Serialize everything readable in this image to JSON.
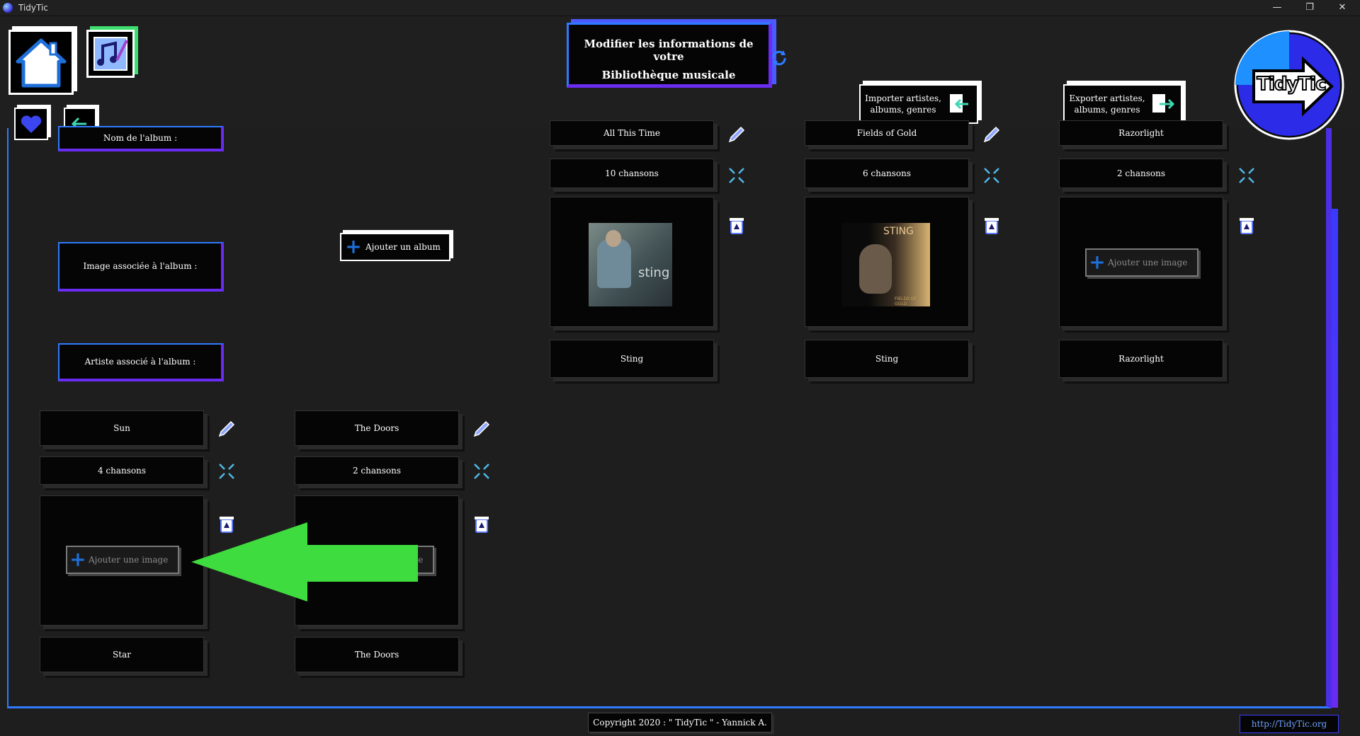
{
  "window": {
    "title": "TidyTic",
    "minimize": "—",
    "restore": "❐",
    "close": "✕"
  },
  "header": {
    "banner_line1": "Modifier les informations de votre",
    "banner_line2": "Bibliothèque musicale",
    "import_label": "Importer artistes, albums, genres",
    "export_label": "Exporter artistes, albums, genres",
    "logo_text": "TidyTic"
  },
  "form": {
    "album_name_label": "Nom de l'album :",
    "album_image_label": "Image associée à l'album :",
    "album_artist_label": "Artiste associé à l'album :",
    "add_album_label": "Ajouter un album"
  },
  "add_image_label": "Ajouter une image",
  "albums": [
    {
      "name": "All This Time",
      "songs": "10 chansons",
      "artist": "Sting"
    },
    {
      "name": "Fields of Gold",
      "songs": "6 chansons",
      "artist": "Sting"
    },
    {
      "name": "Razorlight",
      "songs": "2 chansons",
      "artist": "Razorlight"
    },
    {
      "name": "Sun",
      "songs": "4 chansons",
      "artist": "Star"
    },
    {
      "name": "The Doors",
      "songs": "2 chansons",
      "artist": "The Doors"
    }
  ],
  "covers": {
    "album2_title": "STING",
    "album2_subtitle": "FIELDS OF GOLD",
    "album1_text": "sting"
  },
  "footer": {
    "copyright": "Copyright 2020 : \" TidyTic \" - Yannick A.",
    "link": "http://TidyTic.org"
  },
  "colors": {
    "accent_blue": "#2e7bff",
    "accent_purple": "#6a2bf2",
    "arrow_green": "#3edc3e"
  }
}
